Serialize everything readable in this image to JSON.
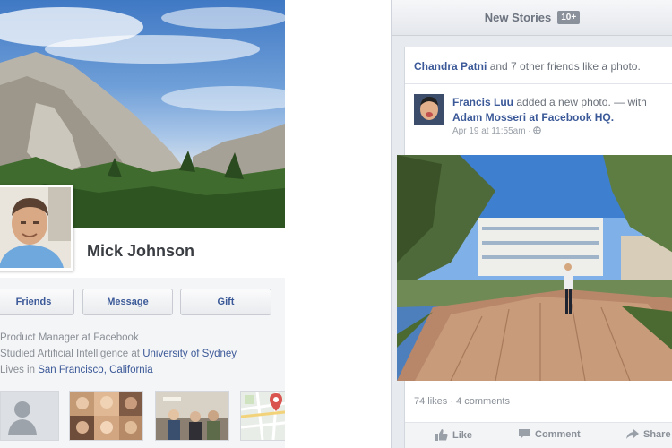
{
  "profile": {
    "name": "Mick Johnson",
    "actions": {
      "friends": "Friends",
      "message": "Message",
      "gift": "Gift"
    },
    "about": {
      "job": "Product Manager at Facebook",
      "studied_prefix": "Studied Artificial Intelligence at ",
      "school": "University of Sydney",
      "lives_prefix": "Lives in ",
      "city": "San Francisco, California"
    },
    "thumbnails": [
      "profile-picture",
      "friends",
      "photos",
      "map"
    ]
  },
  "feed": {
    "header": {
      "title": "New Stories",
      "badge": "10+"
    },
    "story": {
      "social_actor": "Chandra Patni",
      "social_text": " and 7 other friends like a photo.",
      "poster": "Francis Luu",
      "poster_action": " added a new photo. — with ",
      "tagged": "Adam Mosseri at Facebook HQ.",
      "timestamp": "Apr 19 at 11:55am ·",
      "stats": "74 likes · 4 comments",
      "actions": {
        "like": "Like",
        "comment": "Comment",
        "share": "Share"
      }
    }
  },
  "colors": {
    "link": "#3b5998",
    "muted": "#8a8f96",
    "feed_bg": "#e7eaef"
  },
  "icons": [
    "person-silhouette-icon",
    "map-pin-icon",
    "globe-icon",
    "like-icon",
    "comment-icon",
    "share-icon"
  ]
}
